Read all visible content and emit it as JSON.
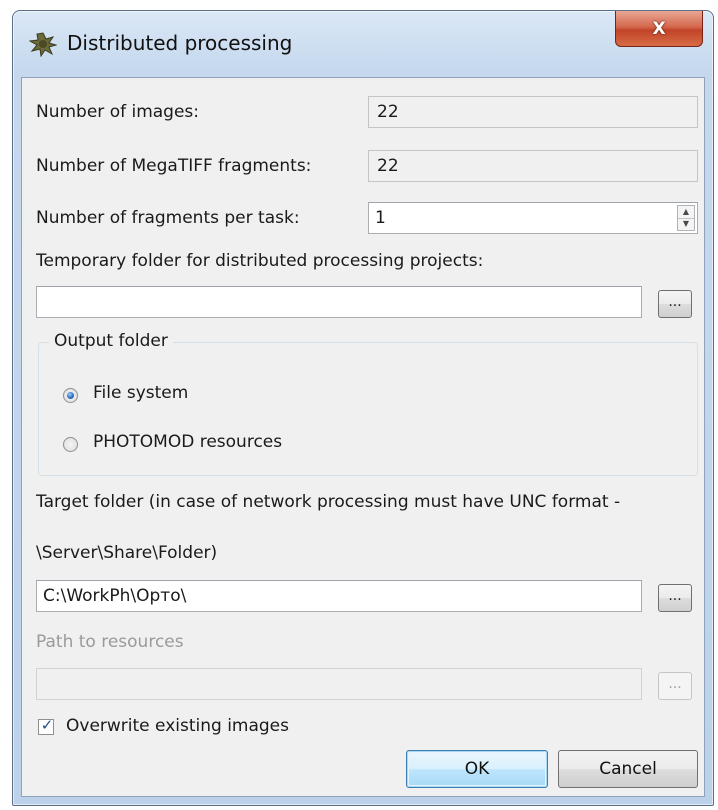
{
  "window": {
    "title": "Distributed processing",
    "app_icon": "photomod-app-icon",
    "close_label": "X"
  },
  "stats": {
    "images_label": "Number of images:",
    "images_value": "22",
    "fragments_label": "Number of MegaTIFF fragments:",
    "fragments_value": "22",
    "per_task_label": "Number of fragments per task:",
    "per_task_value": "1"
  },
  "temp_folder": {
    "label": "Temporary folder for distributed processing projects:",
    "value": "",
    "browse_label": "..."
  },
  "output_folder": {
    "title": "Output folder",
    "options": [
      {
        "label": "File system",
        "selected": true
      },
      {
        "label": "PHOTOMOD resources",
        "selected": false
      }
    ]
  },
  "target_folder": {
    "label_line1": "Target folder (in case of network processing must have UNC format -",
    "label_line2": "\\Server\\Share\\Folder)",
    "value": "C:\\WorkPh\\Орто\\",
    "browse_label": "..."
  },
  "resources": {
    "label": "Path to resources",
    "value": "",
    "browse_label": "..."
  },
  "overwrite": {
    "label": "Overwrite existing images",
    "checked": true
  },
  "buttons": {
    "ok": "OK",
    "cancel": "Cancel"
  },
  "colors": {
    "window_frame": "#c5d8ee",
    "close_button": "#c24429",
    "default_button_border": "#3c7fb1"
  }
}
